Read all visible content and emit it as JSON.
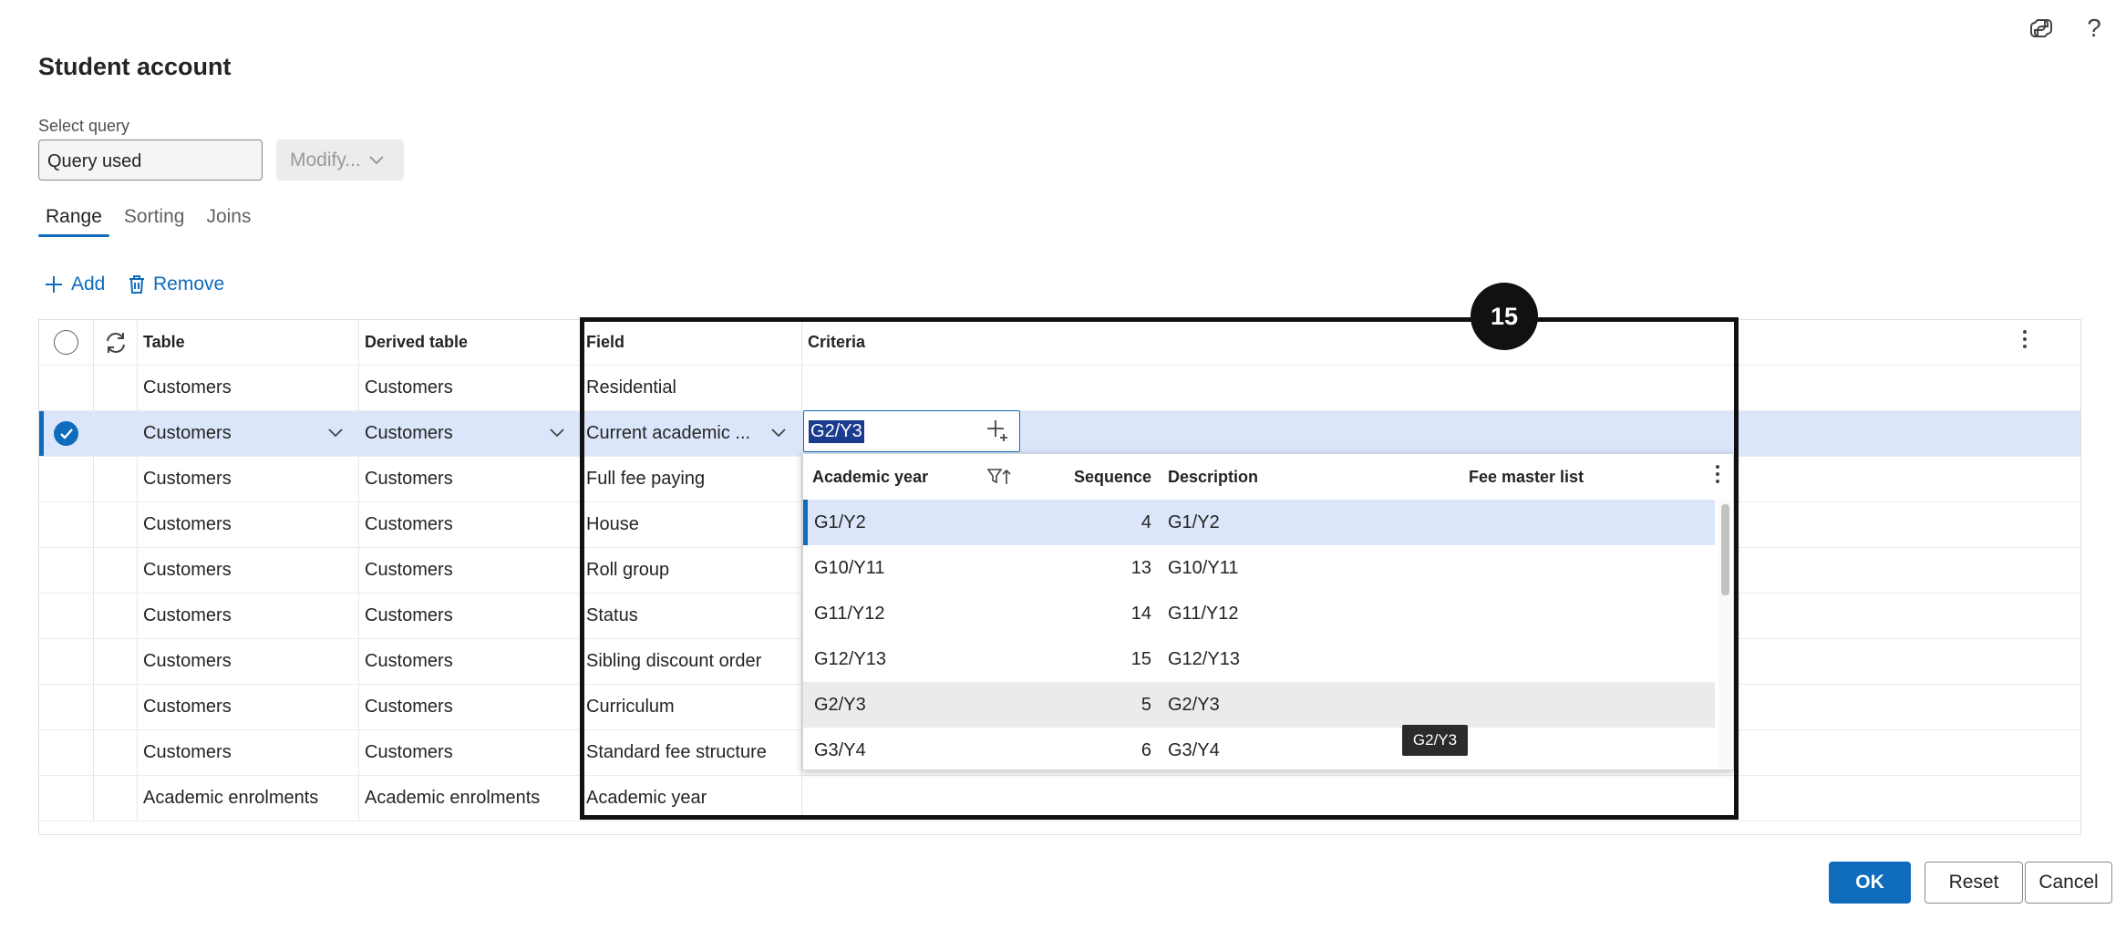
{
  "page": {
    "title": "Student account"
  },
  "top_icons": {
    "copilot": "copilot-icon",
    "help": "?"
  },
  "query": {
    "label": "Select query",
    "value": "Query used",
    "modify_label": "Modify..."
  },
  "tabs": [
    {
      "label": "Range"
    },
    {
      "label": "Sorting"
    },
    {
      "label": "Joins"
    }
  ],
  "actions": {
    "add": "Add",
    "remove": "Remove"
  },
  "grid": {
    "headers": {
      "table": "Table",
      "derived_table": "Derived table",
      "field": "Field",
      "criteria": "Criteria"
    },
    "rows": [
      {
        "table": "Customers",
        "derived": "Customers",
        "field": "Residential",
        "criteria": ""
      },
      {
        "table": "Customers",
        "derived": "Customers",
        "field": "Current academic ...",
        "criteria": "G2/Y3"
      },
      {
        "table": "Customers",
        "derived": "Customers",
        "field": "Full fee paying",
        "criteria": ""
      },
      {
        "table": "Customers",
        "derived": "Customers",
        "field": "House",
        "criteria": ""
      },
      {
        "table": "Customers",
        "derived": "Customers",
        "field": "Roll group",
        "criteria": ""
      },
      {
        "table": "Customers",
        "derived": "Customers",
        "field": "Status",
        "criteria": ""
      },
      {
        "table": "Customers",
        "derived": "Customers",
        "field": "Sibling discount order",
        "criteria": ""
      },
      {
        "table": "Customers",
        "derived": "Customers",
        "field": "Curriculum",
        "criteria": ""
      },
      {
        "table": "Customers",
        "derived": "Customers",
        "field": "Standard fee structure",
        "criteria": ""
      },
      {
        "table": "Academic enrolments",
        "derived": "Academic enrolments",
        "field": "Academic year",
        "criteria": ""
      }
    ]
  },
  "lookup": {
    "headers": {
      "academic_year": "Academic year",
      "sequence": "Sequence",
      "description": "Description",
      "fee_master": "Fee master list"
    },
    "rows": [
      {
        "year": "G1/Y2",
        "seq": "4",
        "desc": "G1/Y2"
      },
      {
        "year": "G10/Y11",
        "seq": "13",
        "desc": "G10/Y11"
      },
      {
        "year": "G11/Y12",
        "seq": "14",
        "desc": "G11/Y12"
      },
      {
        "year": "G12/Y13",
        "seq": "15",
        "desc": "G12/Y13"
      },
      {
        "year": "G2/Y3",
        "seq": "5",
        "desc": "G2/Y3"
      },
      {
        "year": "G3/Y4",
        "seq": "6",
        "desc": "G3/Y4"
      }
    ],
    "tooltip": "G2/Y3"
  },
  "annotation": {
    "badge": "15"
  },
  "buttons": {
    "ok": "OK",
    "reset": "Reset",
    "cancel": "Cancel"
  },
  "colors": {
    "accent": "#0f6cbd",
    "selected_row": "#dbe6fb",
    "highlight_border": "#111111"
  }
}
